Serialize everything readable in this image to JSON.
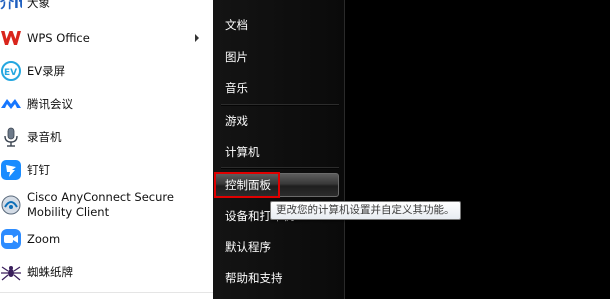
{
  "programs": [
    {
      "label": "大象",
      "icon": "dajiang-icon"
    },
    {
      "label": "WPS Office",
      "icon": "wps-icon",
      "has_submenu": true
    },
    {
      "label": "EV录屏",
      "icon": "ev-recorder-icon"
    },
    {
      "label": "腾讯会议",
      "icon": "tencent-meeting-icon"
    },
    {
      "label": "录音机",
      "icon": "microphone-icon"
    },
    {
      "label": "钉钉",
      "icon": "dingtalk-icon"
    },
    {
      "label": "Cisco AnyConnect Secure Mobility Client",
      "icon": "cisco-anyconnect-icon"
    },
    {
      "label": "Zoom",
      "icon": "zoom-icon"
    },
    {
      "label": "蜘蛛纸牌",
      "icon": "spider-solitaire-icon"
    }
  ],
  "places": [
    {
      "label": "文档"
    },
    {
      "label": "图片"
    },
    {
      "label": "音乐"
    },
    {
      "label": "游戏"
    },
    {
      "label": "计算机"
    },
    {
      "label": "控制面板"
    },
    {
      "label": "设备和打印机"
    },
    {
      "label": "默认程序"
    },
    {
      "label": "帮助和支持"
    }
  ],
  "tooltip": "更改您的计算机设置并自定义其功能。",
  "colors": {
    "highlight_box": "#e00000",
    "wps_red": "#d9251c",
    "tencent_blue": "#1677ff",
    "dingtalk_blue": "#1a8cff",
    "zoom_blue": "#2d8cff"
  }
}
